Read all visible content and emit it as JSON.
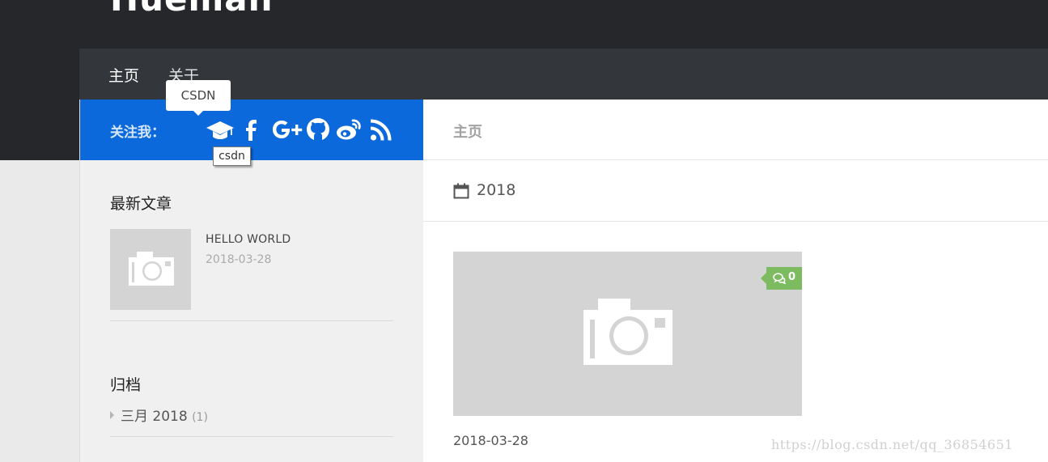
{
  "header": {
    "logo_text": "Hueman"
  },
  "nav": {
    "items": [
      {
        "label": "主页"
      },
      {
        "label": "关于"
      }
    ]
  },
  "sidebar": {
    "follow_label": "关注我：",
    "social_icons": [
      "csdn-graduation-cap-icon",
      "facebook-icon",
      "google-plus-icon",
      "github-icon",
      "weibo-icon",
      "rss-icon"
    ],
    "recent_posts": {
      "title": "最新文章",
      "items": [
        {
          "title": "HELLO WORLD",
          "date": "2018-03-28"
        }
      ]
    },
    "archives": {
      "title": "归档",
      "items": [
        {
          "label": "三月 2018",
          "count": "(1)"
        }
      ]
    }
  },
  "content": {
    "page_heading": "主页",
    "archive_heading": "2018",
    "article": {
      "comment_count": "0",
      "date": "2018-03-28"
    }
  },
  "tooltips": {
    "csdn_tip": "CSDN",
    "native_tip": "csdn"
  },
  "watermark": "https://blog.csdn.net/qq_36854651",
  "colors": {
    "header_bg": "#26272b",
    "nav_bg": "#33363b",
    "follow_bar": "#0c69dc",
    "comment_badge": "#7dbb61",
    "sidebar_bg": "#f0f0f0"
  }
}
